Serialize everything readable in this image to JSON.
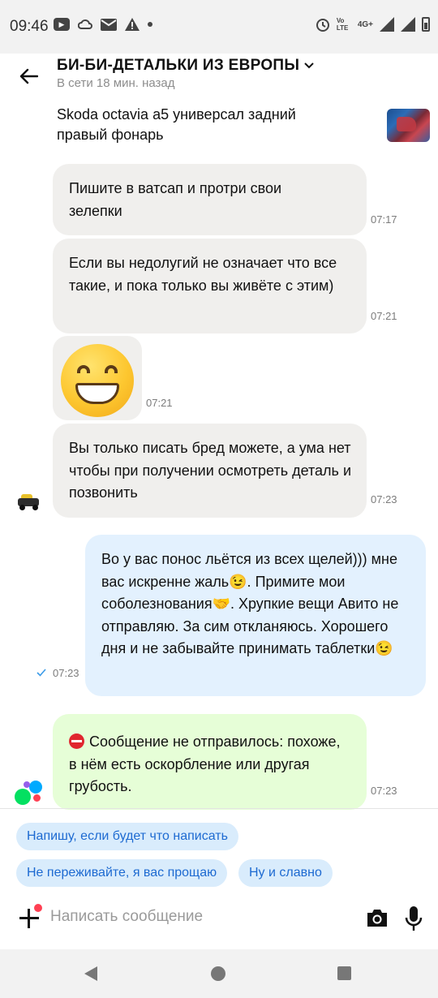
{
  "status_bar": {
    "time": "09:46",
    "network": "4G+",
    "volte": "Vo LTE",
    "icons": [
      "youtube-icon",
      "cloud-icon",
      "mail-icon",
      "warning-icon",
      "dot-icon",
      "alarm-icon",
      "signal-icon",
      "battery-icon"
    ]
  },
  "header": {
    "title": "БИ-БИ-ДЕТАЛЬКИ ИЗ ЕВРОПЫ",
    "status": "В сети 18 мин. назад"
  },
  "listing": {
    "title": "Skoda octavia a5 универсал задний правый фонарь"
  },
  "messages": [
    {
      "side": "in",
      "text": "Пишите в ватсап и протри свои зелепки",
      "time": "07:17"
    },
    {
      "side": "in",
      "text": "Если вы недолугий не означает что все такие, и пока только вы живёте с этим)",
      "time": "07:21"
    },
    {
      "side": "in",
      "emoji": "grinning-face",
      "time": "07:21"
    },
    {
      "side": "in",
      "text": "Вы только писать бред можете, а ума нет чтобы при получении осмотреть деталь и позвонить",
      "time": "07:23"
    },
    {
      "side": "out",
      "text": "Во у вас понос льётся из всех щелей))) мне вас искренне жаль😉. Примите мои соболезнования🤝. Хрупкие вещи Авито не отправляю. За сим откланяюсь. Хорошего дня и не забывайте принимать таблетки😉",
      "time": "07:23",
      "status": "delivered"
    },
    {
      "side": "system",
      "text": "Сообщение не отправилось: похоже, в нём есть оскорбление или другая грубость.",
      "time": "07:23"
    }
  ],
  "quick_replies": [
    "Напишу, если будет что написать",
    "Не переживайте, я вас прощаю",
    "Ну и славно"
  ],
  "composer": {
    "placeholder": "Написать сообщение"
  },
  "colors": {
    "incoming_bubble": "#f0efed",
    "outgoing_bubble": "#e3f1fe",
    "system_bubble": "#e6fed7",
    "chip_bg": "#d9ecfc",
    "chip_text": "#1d6ad1",
    "accent_dot": "#ff4053"
  }
}
